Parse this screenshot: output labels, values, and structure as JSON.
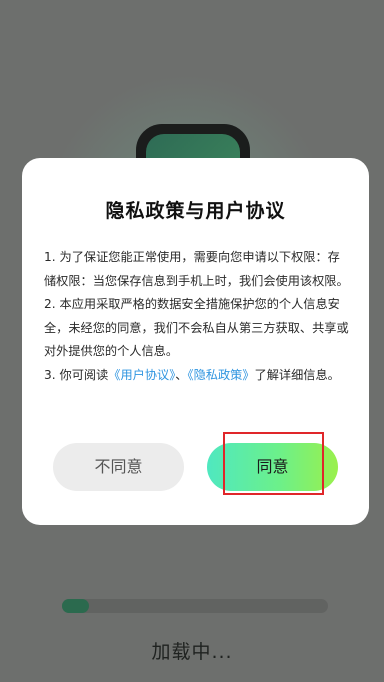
{
  "dialog": {
    "title": "隐私政策与用户协议",
    "para1": "1. 为了保证您能正常使用，需要向您申请以下权限：存储权限：当您保存信息到手机上时，我们会使用该权限。",
    "para2": "2. 本应用采取严格的数据安全措施保护您的个人信息安全，未经您的同意，我们不会私自从第三方获取、共享或对外提供您的个人信息。",
    "para3_prefix": "3. 你可阅读",
    "link_user_agreement": "《用户协议》",
    "separator": "、",
    "link_privacy_policy": "《隐私政策》",
    "para3_suffix": "了解详细信息。",
    "disagree_label": "不同意",
    "agree_label": "同意"
  },
  "splash": {
    "loading_text": "加载中...",
    "progress": 0.1
  },
  "colors": {
    "link": "#2f95e0",
    "highlight_border": "#e0262a",
    "agree_gradient_start": "#4fe8c0",
    "agree_gradient_end": "#9af04c"
  }
}
